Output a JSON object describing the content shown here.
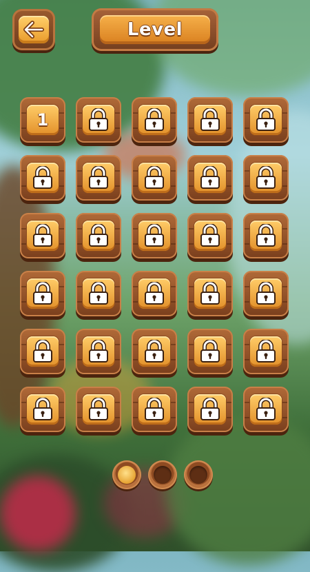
{
  "header": {
    "back_icon": "arrow-left-icon",
    "title": "Level"
  },
  "levels": [
    {
      "number": "1",
      "unlocked": true
    },
    {
      "locked": true,
      "icon": "lock-icon"
    },
    {
      "locked": true,
      "icon": "lock-icon"
    },
    {
      "locked": true,
      "icon": "lock-icon"
    },
    {
      "locked": true,
      "icon": "lock-icon"
    },
    {
      "locked": true,
      "icon": "lock-icon"
    },
    {
      "locked": true,
      "icon": "lock-icon"
    },
    {
      "locked": true,
      "icon": "lock-icon"
    },
    {
      "locked": true,
      "icon": "lock-icon"
    },
    {
      "locked": true,
      "icon": "lock-icon"
    },
    {
      "locked": true,
      "icon": "lock-icon"
    },
    {
      "locked": true,
      "icon": "lock-icon"
    },
    {
      "locked": true,
      "icon": "lock-icon"
    },
    {
      "locked": true,
      "icon": "lock-icon"
    },
    {
      "locked": true,
      "icon": "lock-icon"
    },
    {
      "locked": true,
      "icon": "lock-icon"
    },
    {
      "locked": true,
      "icon": "lock-icon"
    },
    {
      "locked": true,
      "icon": "lock-icon"
    },
    {
      "locked": true,
      "icon": "lock-icon"
    },
    {
      "locked": true,
      "icon": "lock-icon"
    },
    {
      "locked": true,
      "icon": "lock-icon"
    },
    {
      "locked": true,
      "icon": "lock-icon"
    },
    {
      "locked": true,
      "icon": "lock-icon"
    },
    {
      "locked": true,
      "icon": "lock-icon"
    },
    {
      "locked": true,
      "icon": "lock-icon"
    },
    {
      "locked": true,
      "icon": "lock-icon"
    },
    {
      "locked": true,
      "icon": "lock-icon"
    },
    {
      "locked": true,
      "icon": "lock-icon"
    },
    {
      "locked": true,
      "icon": "lock-icon"
    },
    {
      "locked": true,
      "icon": "lock-icon"
    }
  ],
  "pagination": {
    "pages": 3,
    "current": 1
  },
  "colors": {
    "wood": "#8f4e26",
    "gold": "#f0a63a",
    "lock_body": "#ffffff",
    "lock_outline": "#3a2010"
  }
}
